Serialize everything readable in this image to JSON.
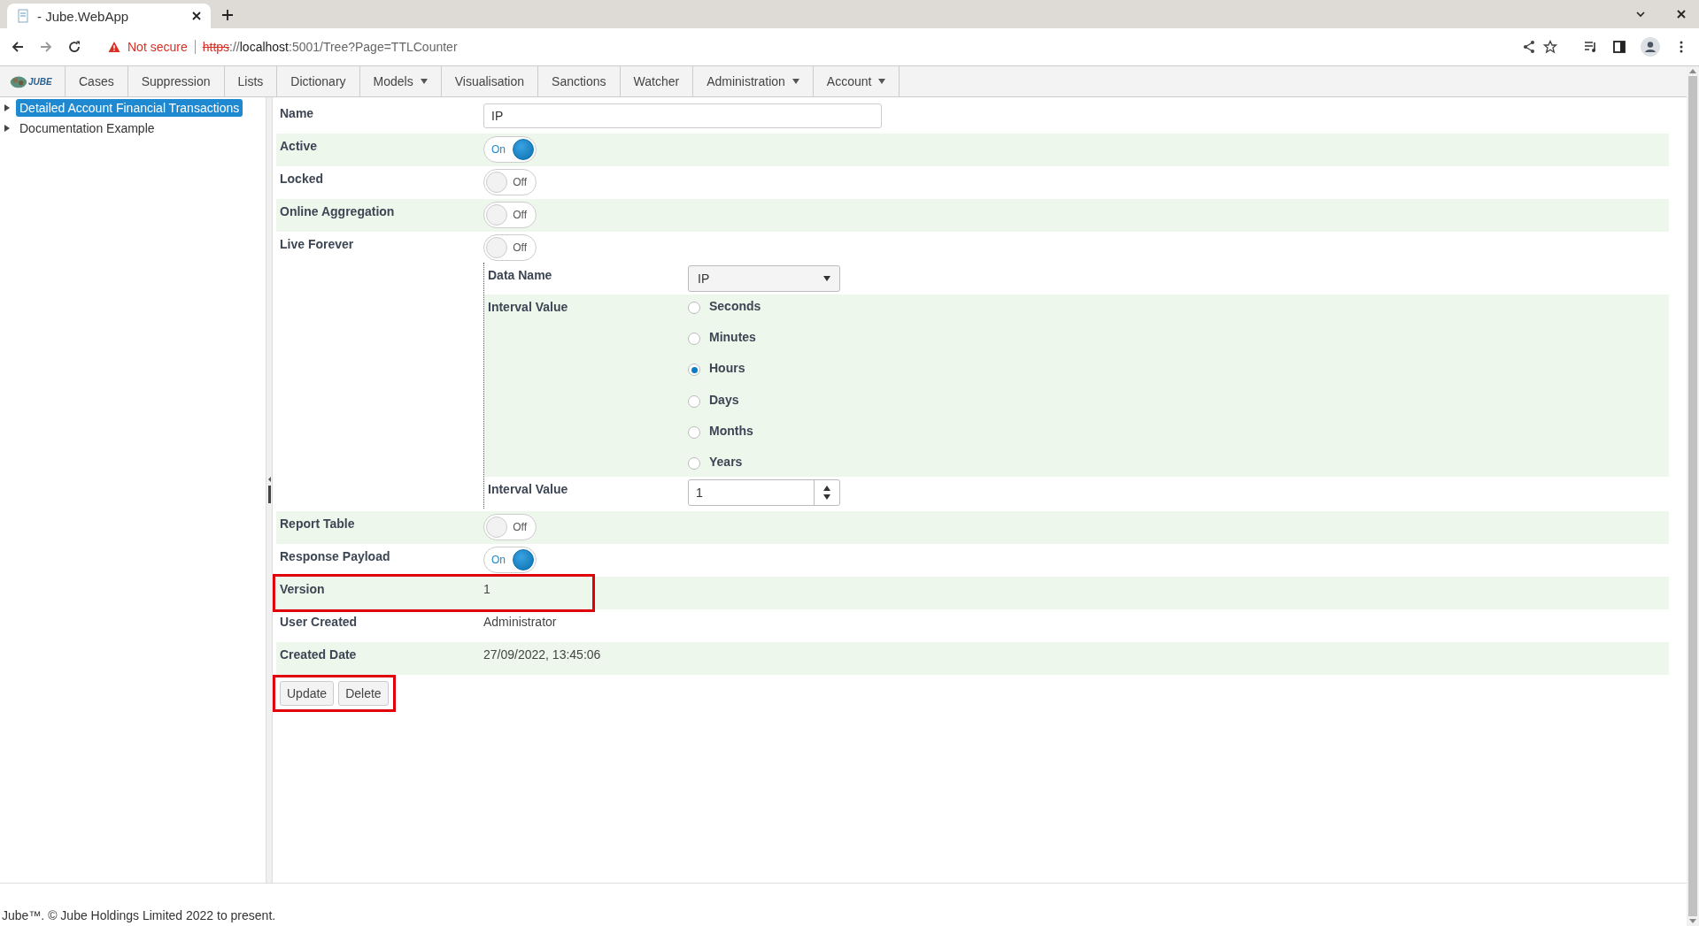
{
  "browser": {
    "tab_title": "- Jube.WebApp",
    "security_label": "Not secure",
    "url_scheme": "https",
    "url_sep": "://",
    "url_host": "localhost",
    "url_rest": ":5001/Tree?Page=TTLCounter"
  },
  "nav": {
    "logo": "JUBE",
    "items": [
      {
        "label": "Cases",
        "dropdown": false
      },
      {
        "label": "Suppression",
        "dropdown": false
      },
      {
        "label": "Lists",
        "dropdown": false
      },
      {
        "label": "Dictionary",
        "dropdown": false
      },
      {
        "label": "Models",
        "dropdown": true
      },
      {
        "label": "Visualisation",
        "dropdown": false
      },
      {
        "label": "Sanctions",
        "dropdown": false
      },
      {
        "label": "Watcher",
        "dropdown": false
      },
      {
        "label": "Administration",
        "dropdown": true
      },
      {
        "label": "Account",
        "dropdown": true
      }
    ]
  },
  "tree": [
    {
      "label": "Detailed Account Financial Transactions",
      "selected": true
    },
    {
      "label": "Documentation Example",
      "selected": false
    }
  ],
  "form": {
    "fields": [
      {
        "kind": "text",
        "label": "Name",
        "value": "IP",
        "highlighted": false
      },
      {
        "kind": "toggle",
        "label": "Active",
        "on": true,
        "text": "On",
        "highlighted": false
      },
      {
        "kind": "toggle",
        "label": "Locked",
        "on": false,
        "text": "Off",
        "highlighted": false
      },
      {
        "kind": "toggle",
        "label": "Online Aggregation",
        "on": false,
        "text": "Off",
        "highlighted": false
      },
      {
        "kind": "toggle",
        "label": "Live Forever",
        "on": false,
        "text": "Off",
        "highlighted": false,
        "children": [
          {
            "kind": "select",
            "label": "Data Name",
            "value": "IP"
          },
          {
            "kind": "radio",
            "label": "Interval Value",
            "options": [
              {
                "label": "Seconds",
                "selected": false
              },
              {
                "label": "Minutes",
                "selected": false
              },
              {
                "label": "Hours",
                "selected": true
              },
              {
                "label": "Days",
                "selected": false
              },
              {
                "label": "Months",
                "selected": false
              },
              {
                "label": "Years",
                "selected": false
              }
            ]
          },
          {
            "kind": "number",
            "label": "Interval Value",
            "value": "1"
          }
        ]
      },
      {
        "kind": "toggle",
        "label": "Report Table",
        "on": false,
        "text": "Off",
        "highlighted": false
      },
      {
        "kind": "toggle",
        "label": "Response Payload",
        "on": true,
        "text": "On",
        "highlighted": false
      },
      {
        "kind": "readonly",
        "label": "Version",
        "value": "1",
        "highlighted": true
      },
      {
        "kind": "readonly",
        "label": "User Created",
        "value": "Administrator",
        "highlighted": false
      },
      {
        "kind": "readonly",
        "label": "Created Date",
        "value": "27/09/2022, 13:45:06",
        "highlighted": false
      }
    ],
    "buttons": [
      "Update",
      "Delete"
    ],
    "buttons_highlighted": true
  },
  "footer": "Jube™. © Jube Holdings Limited 2022 to present."
}
